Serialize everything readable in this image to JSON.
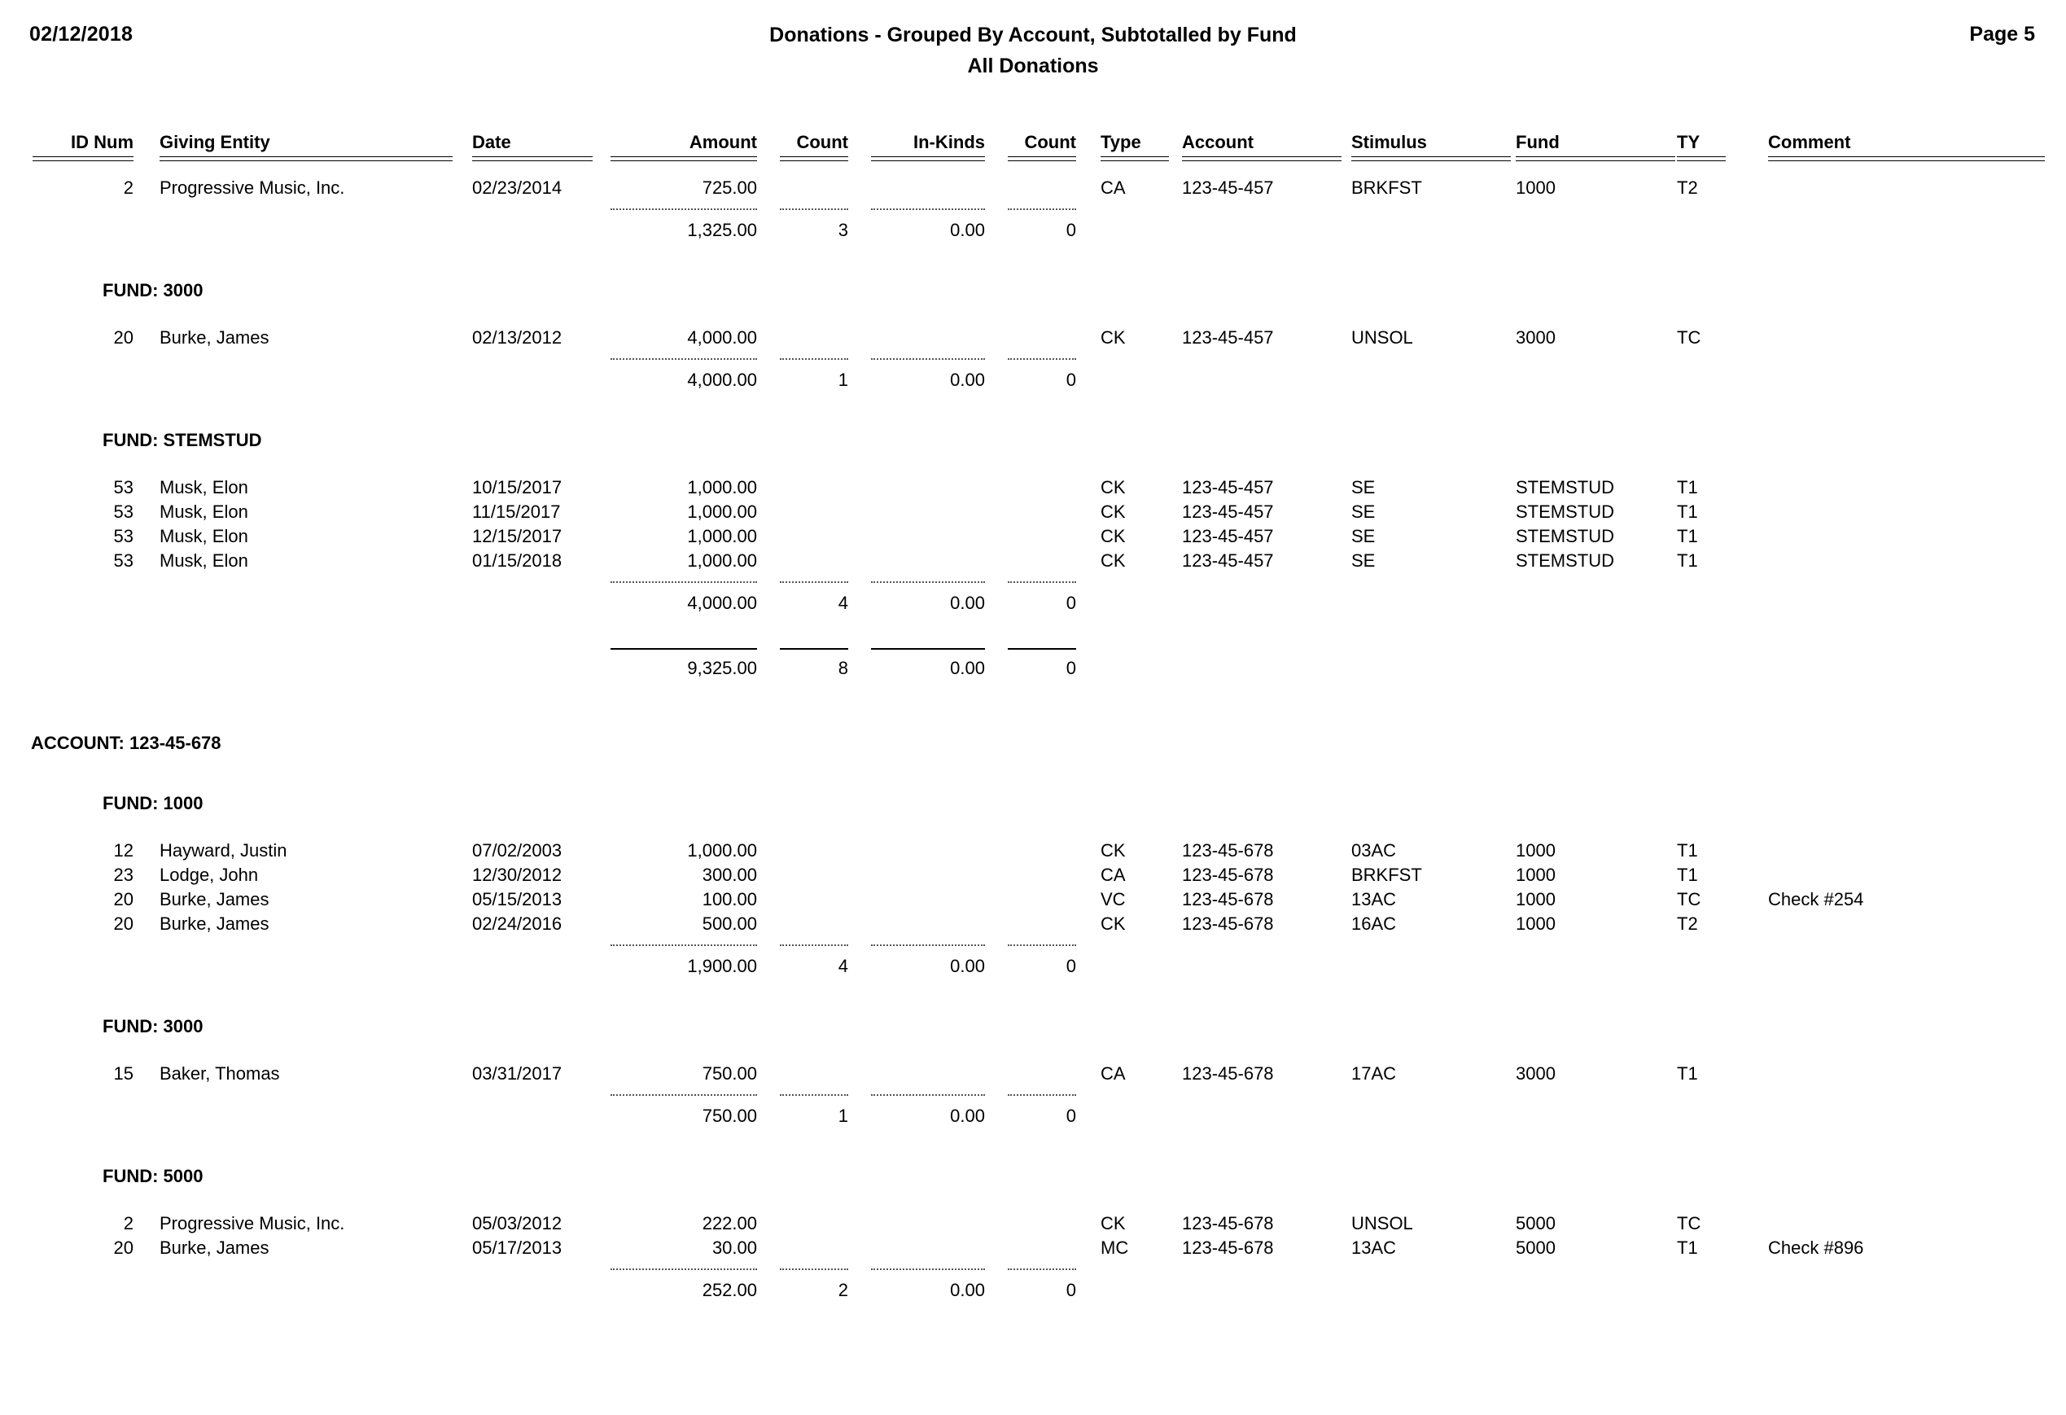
{
  "header": {
    "date": "02/12/2018",
    "title": "Donations - Grouped By Account, Subtotalled by Fund",
    "subtitle": "All Donations",
    "page_label": "Page 5"
  },
  "columns": {
    "id_num": "ID Num",
    "giving_entity": "Giving Entity",
    "date": "Date",
    "amount": "Amount",
    "count1": "Count",
    "in_kinds": "In-Kinds",
    "count2": "Count",
    "type": "Type",
    "account": "Account",
    "stimulus": "Stimulus",
    "fund": "Fund",
    "ty": "TY",
    "comment": "Comment"
  },
  "rows": {
    "r1": {
      "id": "2",
      "entity": "Progressive Music, Inc.",
      "date": "02/23/2014",
      "amount": "725.00",
      "count1": "",
      "inkinds": "",
      "count2": "",
      "type": "CA",
      "account": "123-45-457",
      "stimulus": "BRKFST",
      "fund": "1000",
      "ty": "T2",
      "comment": ""
    },
    "sub1": {
      "amount": "1,325.00",
      "count1": "3",
      "inkinds": "0.00",
      "count2": "0"
    },
    "r2": {
      "id": "20",
      "entity": "Burke, James",
      "date": "02/13/2012",
      "amount": "4,000.00",
      "count1": "",
      "inkinds": "",
      "count2": "",
      "type": "CK",
      "account": "123-45-457",
      "stimulus": "UNSOL",
      "fund": "3000",
      "ty": "TC",
      "comment": ""
    },
    "sub2": {
      "amount": "4,000.00",
      "count1": "1",
      "inkinds": "0.00",
      "count2": "0"
    },
    "r3": {
      "id": "53",
      "entity": "Musk, Elon",
      "date": "10/15/2017",
      "amount": "1,000.00",
      "count1": "",
      "inkinds": "",
      "count2": "",
      "type": "CK",
      "account": "123-45-457",
      "stimulus": "SE",
      "fund": "STEMSTUD",
      "ty": "T1",
      "comment": ""
    },
    "r4": {
      "id": "53",
      "entity": "Musk, Elon",
      "date": "11/15/2017",
      "amount": "1,000.00",
      "count1": "",
      "inkinds": "",
      "count2": "",
      "type": "CK",
      "account": "123-45-457",
      "stimulus": "SE",
      "fund": "STEMSTUD",
      "ty": "T1",
      "comment": ""
    },
    "r5": {
      "id": "53",
      "entity": "Musk, Elon",
      "date": "12/15/2017",
      "amount": "1,000.00",
      "count1": "",
      "inkinds": "",
      "count2": "",
      "type": "CK",
      "account": "123-45-457",
      "stimulus": "SE",
      "fund": "STEMSTUD",
      "ty": "T1",
      "comment": ""
    },
    "r6": {
      "id": "53",
      "entity": "Musk, Elon",
      "date": "01/15/2018",
      "amount": "1,000.00",
      "count1": "",
      "inkinds": "",
      "count2": "",
      "type": "CK",
      "account": "123-45-457",
      "stimulus": "SE",
      "fund": "STEMSTUD",
      "ty": "T1",
      "comment": ""
    },
    "sub3": {
      "amount": "4,000.00",
      "count1": "4",
      "inkinds": "0.00",
      "count2": "0"
    },
    "acct_total_1": {
      "amount": "9,325.00",
      "count1": "8",
      "inkinds": "0.00",
      "count2": "0"
    },
    "r7": {
      "id": "12",
      "entity": "Hayward, Justin",
      "date": "07/02/2003",
      "amount": "1,000.00",
      "count1": "",
      "inkinds": "",
      "count2": "",
      "type": "CK",
      "account": "123-45-678",
      "stimulus": "03AC",
      "fund": "1000",
      "ty": "T1",
      "comment": ""
    },
    "r8": {
      "id": "23",
      "entity": "Lodge, John",
      "date": "12/30/2012",
      "amount": "300.00",
      "count1": "",
      "inkinds": "",
      "count2": "",
      "type": "CA",
      "account": "123-45-678",
      "stimulus": "BRKFST",
      "fund": "1000",
      "ty": "T1",
      "comment": ""
    },
    "r9": {
      "id": "20",
      "entity": "Burke, James",
      "date": "05/15/2013",
      "amount": "100.00",
      "count1": "",
      "inkinds": "",
      "count2": "",
      "type": "VC",
      "account": "123-45-678",
      "stimulus": "13AC",
      "fund": "1000",
      "ty": "TC",
      "comment": "Check #254"
    },
    "r10": {
      "id": "20",
      "entity": "Burke, James",
      "date": "02/24/2016",
      "amount": "500.00",
      "count1": "",
      "inkinds": "",
      "count2": "",
      "type": "CK",
      "account": "123-45-678",
      "stimulus": "16AC",
      "fund": "1000",
      "ty": "T2",
      "comment": ""
    },
    "sub4": {
      "amount": "1,900.00",
      "count1": "4",
      "inkinds": "0.00",
      "count2": "0"
    },
    "r11": {
      "id": "15",
      "entity": "Baker, Thomas",
      "date": "03/31/2017",
      "amount": "750.00",
      "count1": "",
      "inkinds": "",
      "count2": "",
      "type": "CA",
      "account": "123-45-678",
      "stimulus": "17AC",
      "fund": "3000",
      "ty": "T1",
      "comment": ""
    },
    "sub5": {
      "amount": "750.00",
      "count1": "1",
      "inkinds": "0.00",
      "count2": "0"
    },
    "r12": {
      "id": "2",
      "entity": "Progressive Music, Inc.",
      "date": "05/03/2012",
      "amount": "222.00",
      "count1": "",
      "inkinds": "",
      "count2": "",
      "type": "CK",
      "account": "123-45-678",
      "stimulus": "UNSOL",
      "fund": "5000",
      "ty": "TC",
      "comment": ""
    },
    "r13": {
      "id": "20",
      "entity": "Burke, James",
      "date": "05/17/2013",
      "amount": "30.00",
      "count1": "",
      "inkinds": "",
      "count2": "",
      "type": "MC",
      "account": "123-45-678",
      "stimulus": "13AC",
      "fund": "5000",
      "ty": "T1",
      "comment": "Check #896"
    },
    "sub6": {
      "amount": "252.00",
      "count1": "2",
      "inkinds": "0.00",
      "count2": "0"
    }
  },
  "groups": {
    "fund_3000_a": "FUND: 3000",
    "fund_stemstud": "FUND: STEMSTUD",
    "account_123_45_678": "ACCOUNT: 123-45-678",
    "fund_1000_b": "FUND: 1000",
    "fund_3000_b": "FUND: 3000",
    "fund_5000_b": "FUND: 5000"
  }
}
